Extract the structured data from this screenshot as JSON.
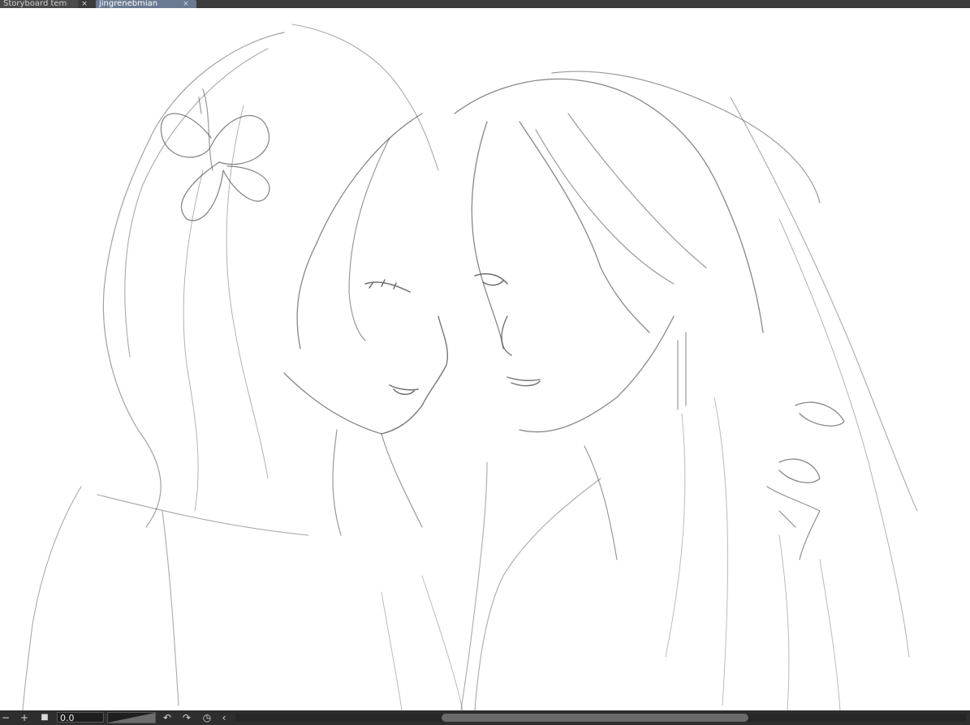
{
  "tabs": [
    {
      "label": "Storyboard tem",
      "active": false
    },
    {
      "label": "jingrenebmian",
      "active": true
    }
  ],
  "status_bar": {
    "zoom_out_glyph": "−",
    "zoom_in_glyph": "+",
    "fit_glyph": "■",
    "rotation_value": "0.0",
    "undo_glyph": "↶",
    "redo_glyph": "↷",
    "reset_glyph": "◷",
    "collapse_glyph": "‹"
  },
  "colors": {
    "tab_bar": "#3b3b3b",
    "active_tab": "#6a7a92",
    "status_bar": "#2e2e2e",
    "sketch_stroke": "#555555"
  },
  "canvas": {
    "content": "pencil sketch of two figures with long hair leaning their heads together"
  }
}
